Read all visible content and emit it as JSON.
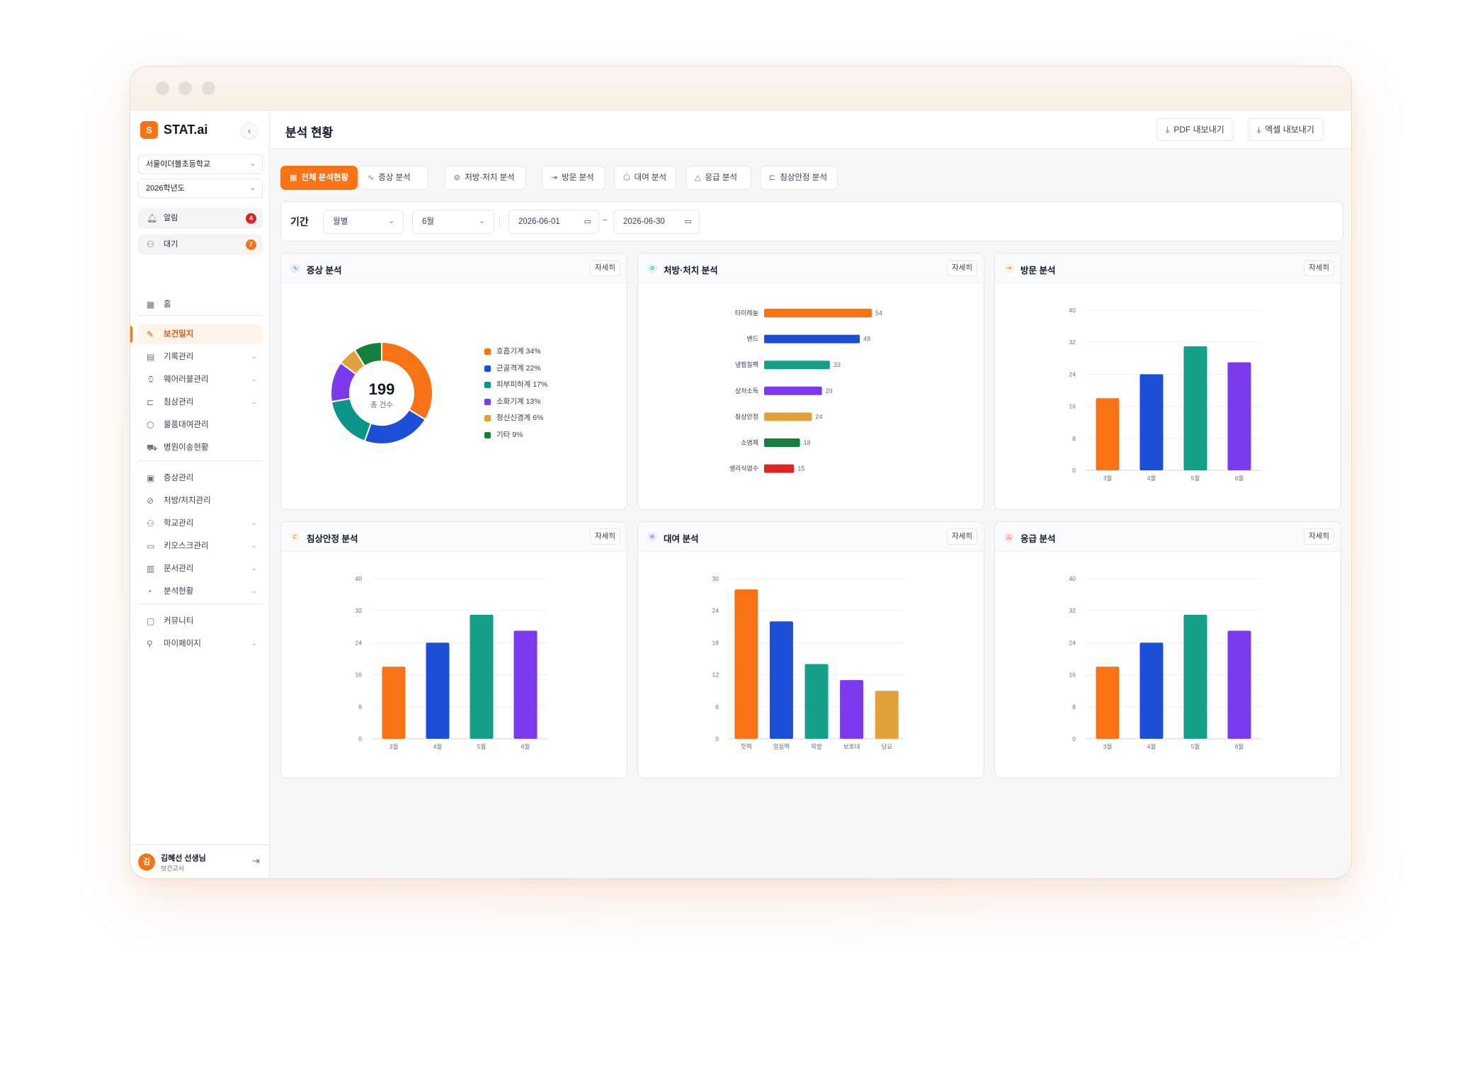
{
  "app": {
    "logo_letter": "S",
    "name": "STAT.ai"
  },
  "sidebar": {
    "collapse_icon": "chevron-left-icon",
    "school": "서울이더블초등학교",
    "year": "2026학년도",
    "alerts": [
      {
        "label": "알림",
        "count": "4",
        "icon": "bell-icon",
        "color": "#dc2626"
      },
      {
        "label": "대기",
        "count": "7",
        "icon": "user-plus-icon",
        "color": "#f97316"
      }
    ],
    "nav": [
      {
        "label": "홈",
        "icon": "grid-icon",
        "has_children": false,
        "active": false
      },
      {
        "label": "보건일지",
        "icon": "edit-icon",
        "has_children": false,
        "active": true
      },
      {
        "label": "기록관리",
        "icon": "file-icon",
        "has_children": true,
        "active": false
      },
      {
        "label": "웨어러블관리",
        "icon": "watch-icon",
        "has_children": true,
        "active": false
      },
      {
        "label": "침상관리",
        "icon": "bed-icon",
        "has_children": true,
        "active": false
      },
      {
        "label": "물품대여관리",
        "icon": "box-icon",
        "has_children": false,
        "active": false
      },
      {
        "label": "병원이송현황",
        "icon": "ambulance-icon",
        "has_children": false,
        "active": false
      },
      {
        "label": "증상관리",
        "icon": "clipboard-icon",
        "has_children": false,
        "active": false
      },
      {
        "label": "처방/처치관리",
        "icon": "pill-icon",
        "has_children": false,
        "active": false
      },
      {
        "label": "학교관리",
        "icon": "users-icon",
        "has_children": true,
        "active": false
      },
      {
        "label": "키오스크관리",
        "icon": "monitor-icon",
        "has_children": true,
        "active": false
      },
      {
        "label": "문서관리",
        "icon": "document-icon",
        "has_children": true,
        "active": false
      },
      {
        "label": "분석현황",
        "icon": "pie-icon",
        "has_children": true,
        "active": false
      },
      {
        "label": "커뮤니티",
        "icon": "message-icon",
        "has_children": false,
        "active": false
      },
      {
        "label": "마이페이지",
        "icon": "user-icon",
        "has_children": true,
        "active": false
      }
    ],
    "user": {
      "avatar": "김",
      "name": "김혜선 선생님",
      "role": "보건교사",
      "logout_icon": "logout-icon"
    }
  },
  "header": {
    "title": "분석 현황",
    "pdf_export": "PDF 내보내기",
    "excel_export": "엑셀 내보내기",
    "download_icon": "download-icon"
  },
  "tabs": [
    {
      "label": "전체 분석현황",
      "icon": "grid-icon",
      "active": true
    },
    {
      "label": "증상 분석",
      "icon": "activity-icon",
      "active": false
    },
    {
      "label": "처방·처치 분석",
      "icon": "pill-icon",
      "active": false
    },
    {
      "label": "방문 분석",
      "icon": "login-icon",
      "active": false
    },
    {
      "label": "대여 분석",
      "icon": "box-icon",
      "active": false
    },
    {
      "label": "응급 분석",
      "icon": "alert-icon",
      "active": false
    },
    {
      "label": "침상안정 분석",
      "icon": "bed-icon",
      "active": false
    }
  ],
  "filter": {
    "label": "기간",
    "period_type": "월별",
    "month": "6월",
    "start_date": "2026-06-01",
    "end_date": "2026-06-30",
    "separator": "~"
  },
  "cards": [
    {
      "title": "증상 분석",
      "detail": "자세히",
      "icon": "activity-icon",
      "accent": "#2563eb",
      "accent_bg": "#e8efff"
    },
    {
      "title": "처방·처치 분석",
      "detail": "자세히",
      "icon": "pill-icon",
      "accent": "#0d9488",
      "accent_bg": "#e2f5f1"
    },
    {
      "title": "방문 분석",
      "detail": "자세히",
      "icon": "login-icon",
      "accent": "#f97316",
      "accent_bg": "#fff0e3"
    },
    {
      "title": "침상안정 분석",
      "detail": "자세히",
      "icon": "bed-icon",
      "accent": "#d97706",
      "accent_bg": "#fff4dc"
    },
    {
      "title": "대여 분석",
      "detail": "자세히",
      "icon": "box-icon",
      "accent": "#7c3aed",
      "accent_bg": "#f0e9ff"
    },
    {
      "title": "응급 분석",
      "detail": "자세히",
      "icon": "alert-icon",
      "accent": "#dc2626",
      "accent_bg": "#fde8e8"
    }
  ],
  "chart_data": [
    {
      "type": "pie",
      "donut": true,
      "center_value": "199",
      "center_label": "총 건수",
      "slices": [
        {
          "label": "호흡기계 34%",
          "value": 34,
          "color": "#f97316"
        },
        {
          "label": "근골격계 22%",
          "value": 22,
          "color": "#1d4ed8"
        },
        {
          "label": "피부피하계 17%",
          "value": 17,
          "color": "#0d9488"
        },
        {
          "label": "소화기계 13%",
          "value": 13,
          "color": "#7c3aed"
        },
        {
          "label": "정신신경계 6%",
          "value": 6,
          "color": "#e3a13b"
        },
        {
          "label": "기타 9%",
          "value": 9,
          "color": "#15803d"
        }
      ]
    },
    {
      "type": "bar",
      "orientation": "horizontal",
      "categories": [
        "타이레놀",
        "밴드",
        "냉찜질팩",
        "상처소독",
        "침상안정",
        "소염제",
        "생리식염수"
      ],
      "values": [
        54,
        48,
        33,
        29,
        24,
        18,
        15
      ],
      "colors": [
        "#f97316",
        "#1d4ed8",
        "#14a089",
        "#7c3aed",
        "#e3a13b",
        "#15803d",
        "#dc2626"
      ],
      "xlim": [
        0,
        54
      ]
    },
    {
      "type": "bar",
      "categories": [
        "3월",
        "4월",
        "5월",
        "6월"
      ],
      "values": [
        18,
        24,
        31,
        27
      ],
      "colors": [
        "#f97316",
        "#1d4ed8",
        "#14a089",
        "#7c3aed"
      ],
      "ylim": [
        0,
        40
      ],
      "yticks": [
        0,
        8,
        16,
        24,
        32,
        40
      ],
      "grid": true
    },
    {
      "type": "bar",
      "categories": [
        "3월",
        "4월",
        "5월",
        "6월"
      ],
      "values": [
        18,
        24,
        31,
        27
      ],
      "colors": [
        "#f97316",
        "#1d4ed8",
        "#14a089",
        "#7c3aed"
      ],
      "ylim": [
        0,
        40
      ],
      "yticks": [
        0,
        8,
        16,
        24,
        32,
        40
      ],
      "grid": true
    },
    {
      "type": "bar",
      "categories": [
        "핫팩",
        "얼음팩",
        "목발",
        "보호대",
        "담요"
      ],
      "values": [
        28,
        22,
        14,
        11,
        9
      ],
      "colors": [
        "#f97316",
        "#1d4ed8",
        "#14a089",
        "#7c3aed",
        "#e3a13b"
      ],
      "ylim": [
        0,
        30
      ],
      "yticks": [
        0,
        6,
        12,
        18,
        24,
        30
      ],
      "grid": true
    },
    {
      "type": "bar",
      "categories": [
        "3월",
        "4월",
        "5월",
        "6월"
      ],
      "values": [
        18,
        24,
        31,
        27
      ],
      "colors": [
        "#f97316",
        "#1d4ed8",
        "#14a089",
        "#7c3aed"
      ],
      "ylim": [
        0,
        40
      ],
      "yticks": [
        0,
        8,
        16,
        24,
        32,
        40
      ],
      "grid": true
    }
  ]
}
